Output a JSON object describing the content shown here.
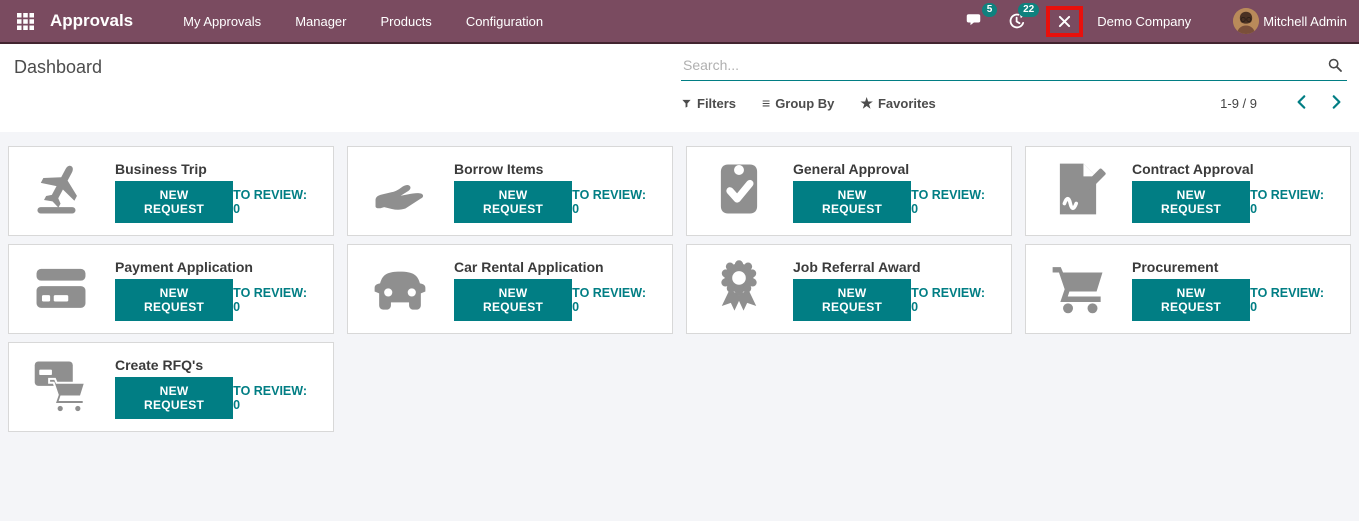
{
  "navbar": {
    "app_name": "Approvals",
    "menu_items": [
      "My Approvals",
      "Manager",
      "Products",
      "Configuration"
    ],
    "messages_badge": "5",
    "activities_badge": "22",
    "company_name": "Demo Company",
    "user_name": "Mitchell Admin"
  },
  "control_panel": {
    "breadcrumb": "Dashboard",
    "search_placeholder": "Search...",
    "filters_label": "Filters",
    "group_by_label": "Group By",
    "favorites_label": "Favorites",
    "pager_text": "1-9 / 9"
  },
  "card_labels": {
    "new_request": "NEW REQUEST",
    "to_review": "TO REVIEW:"
  },
  "cards": [
    {
      "title": "Business Trip",
      "icon": "plane-departure-icon",
      "to_review_count": "0"
    },
    {
      "title": "Borrow Items",
      "icon": "hand-icon",
      "to_review_count": "0"
    },
    {
      "title": "General Approval",
      "icon": "clipboard-check-icon",
      "to_review_count": "0"
    },
    {
      "title": "Contract Approval",
      "icon": "contract-sign-icon",
      "to_review_count": "0"
    },
    {
      "title": "Payment Application",
      "icon": "credit-card-icon",
      "to_review_count": "0"
    },
    {
      "title": "Car Rental Application",
      "icon": "car-icon",
      "to_review_count": "0"
    },
    {
      "title": "Job Referral Award",
      "icon": "medal-icon",
      "to_review_count": "0"
    },
    {
      "title": "Procurement",
      "icon": "shopping-cart-icon",
      "to_review_count": "0"
    },
    {
      "title": "Create RFQ's",
      "icon": "card-cart-icon",
      "to_review_count": "0"
    }
  ],
  "colors": {
    "navbar_bg": "#7a4b60",
    "accent_teal": "#017e84",
    "badge_teal": "#0f817e",
    "icon_gray": "#8f8f8f",
    "debug_highlight_red": "#e8100c"
  }
}
